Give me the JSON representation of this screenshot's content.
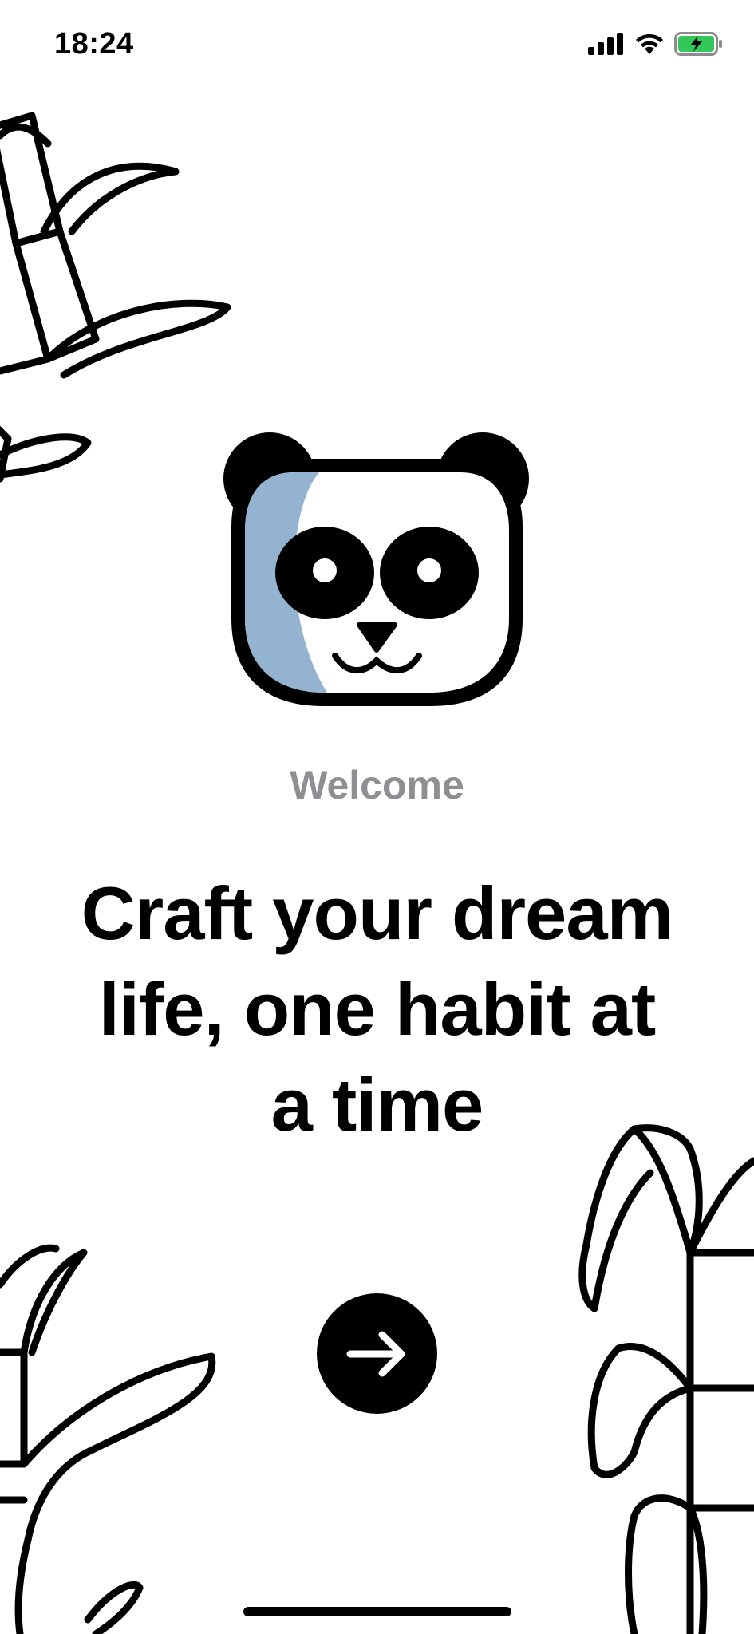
{
  "status_bar": {
    "time": "18:24",
    "icons": [
      "signal-icon",
      "wifi-icon",
      "battery-charging-icon"
    ],
    "battery_color": "#34c759"
  },
  "welcome": {
    "label": "Welcome",
    "headline": "Craft your dream life, one habit at a time"
  },
  "next_button": {
    "icon": "arrow-right-icon"
  },
  "colors": {
    "label_gray": "#8e8e93",
    "panda_shade": "#94b3d1"
  }
}
